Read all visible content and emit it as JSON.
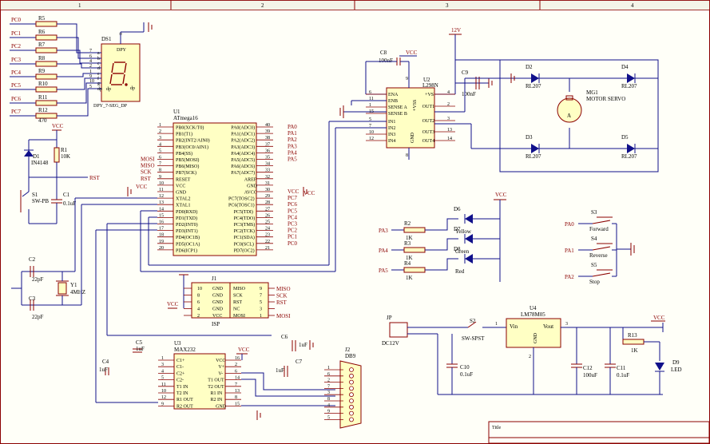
{
  "border": {
    "columns": [
      "1",
      "2",
      "3",
      "4"
    ]
  },
  "power_labels": {
    "vcc": "VCC",
    "v12": "12V"
  },
  "ds1": {
    "ref": "DS1",
    "name": "DPY_7-SEG_DP",
    "top": "DPY",
    "nets": [
      "PC0",
      "PC1",
      "PC2",
      "PC3",
      "PC4",
      "PC5",
      "PC6",
      "PC7"
    ],
    "resistors": [
      "R5",
      "R6",
      "R7",
      "R8",
      "R9",
      "R10",
      "R11",
      "R12"
    ],
    "value": "470",
    "seg_letters": [
      "a",
      "b",
      "c",
      "d",
      "e",
      "f",
      "g",
      "dp"
    ],
    "seg_pins": [
      "7",
      "6",
      "4",
      "2",
      "1",
      "9",
      "10",
      "5"
    ],
    "pin_left_numbers": [
      "7",
      "6",
      "4",
      "2",
      "1",
      "9",
      "10",
      "5"
    ],
    "right_labels": [
      "f",
      "g",
      "e",
      "d",
      "dp",
      "a",
      "b",
      "c"
    ]
  },
  "u1": {
    "ref": "U1",
    "part": "ATmega16",
    "left": [
      {
        "n": "1",
        "name": "PB0(XCK/T0)",
        "net": ""
      },
      {
        "n": "2",
        "name": "PB1(T1)",
        "net": ""
      },
      {
        "n": "3",
        "name": "PB2(INT2/AIN0)",
        "net": ""
      },
      {
        "n": "4",
        "name": "PB3(OC0/AIN1)",
        "net": ""
      },
      {
        "n": "5",
        "name": "PB4(SS)",
        "net": ""
      },
      {
        "n": "6",
        "name": "PB5(MOSI)",
        "net": "MOSI"
      },
      {
        "n": "7",
        "name": "PB6(MISO)",
        "net": "MISO"
      },
      {
        "n": "8",
        "name": "PB7(SCK)",
        "net": "SCK"
      },
      {
        "n": "9",
        "name": "RESET",
        "net": "RST"
      },
      {
        "n": "10",
        "name": "VCC",
        "net": ""
      },
      {
        "n": "11",
        "name": "GND",
        "net": ""
      },
      {
        "n": "12",
        "name": "XTAL2",
        "net": ""
      },
      {
        "n": "13",
        "name": "XTAL1",
        "net": ""
      },
      {
        "n": "14",
        "name": "PD0(RXD)",
        "net": ""
      },
      {
        "n": "15",
        "name": "PD1(TXD)",
        "net": ""
      },
      {
        "n": "16",
        "name": "PD2(INT0)",
        "net": ""
      },
      {
        "n": "17",
        "name": "PD3(INT1)",
        "net": ""
      },
      {
        "n": "18",
        "name": "PD4(OC1B)",
        "net": ""
      },
      {
        "n": "19",
        "name": "PD5(OC1A)",
        "net": ""
      },
      {
        "n": "20",
        "name": "PD6(ICP1)",
        "net": ""
      }
    ],
    "right": [
      {
        "n": "40",
        "name": "PA0(ADC0)",
        "net": "PA0"
      },
      {
        "n": "39",
        "name": "PA1(ADC1)",
        "net": "PA1"
      },
      {
        "n": "38",
        "name": "PA2(ADC2)",
        "net": "PA2"
      },
      {
        "n": "37",
        "name": "PA3(ADC3)",
        "net": "PA3"
      },
      {
        "n": "36",
        "name": "PA4(ADC4)",
        "net": "PA4"
      },
      {
        "n": "35",
        "name": "PA5(ADC5)",
        "net": "PA5"
      },
      {
        "n": "34",
        "name": "PA6(ADC6)",
        "net": ""
      },
      {
        "n": "33",
        "name": "PA7(ADC7)",
        "net": ""
      },
      {
        "n": "32",
        "name": "AREF",
        "net": ""
      },
      {
        "n": "31",
        "name": "GND",
        "net": ""
      },
      {
        "n": "30",
        "name": "AVCC",
        "net": "VCC"
      },
      {
        "n": "29",
        "name": "PC7(TOSC2)",
        "net": "PC7"
      },
      {
        "n": "28",
        "name": "PC6(TOSC1)",
        "net": "PC6"
      },
      {
        "n": "27",
        "name": "PC5(TDI)",
        "net": "PC5"
      },
      {
        "n": "26",
        "name": "PC4(TDO)",
        "net": "PC4"
      },
      {
        "n": "25",
        "name": "PC3(TMS)",
        "net": "PC3"
      },
      {
        "n": "24",
        "name": "PC2(TCK)",
        "net": "PC2"
      },
      {
        "n": "23",
        "name": "PC1(SDA)",
        "net": "PC1"
      },
      {
        "n": "22",
        "name": "PC0(SCL)",
        "net": "PC0"
      },
      {
        "n": "21",
        "name": "PD7(OC2)",
        "net": ""
      }
    ]
  },
  "reset": {
    "d1": "D1",
    "d1v": "IN4148",
    "r1": "R1",
    "r1v": "10K",
    "s1": "S1",
    "s1v": "SW-PB",
    "c1": "C1",
    "c1v": "0.1uF",
    "rst": "RST"
  },
  "crystal": {
    "c2": "C2",
    "c2v": "22pF",
    "c3": "C3",
    "c3v": "22pF",
    "y1": "Y1",
    "y1v": "4MHZ"
  },
  "u2": {
    "ref": "U2",
    "part": "L298N",
    "left": [
      {
        "n": "6",
        "name": "ENA"
      },
      {
        "n": "11",
        "name": "ENB"
      },
      {
        "n": "1",
        "name": "SENSE A"
      },
      {
        "n": "15",
        "name": "SENSE B"
      },
      {
        "n": "5",
        "name": "IN1"
      },
      {
        "n": "7",
        "name": "IN2"
      },
      {
        "n": "10",
        "name": "IN3"
      },
      {
        "n": "12",
        "name": "IN4"
      }
    ],
    "right": [
      {
        "n": "4",
        "name": "+VS"
      },
      {
        "n": "2",
        "name": "OUT1"
      },
      {
        "n": "3",
        "name": "OUT2"
      },
      {
        "n": "13",
        "name": "OUT3"
      },
      {
        "n": "14",
        "name": "OUT4"
      }
    ],
    "vss": "+VSS",
    "vss_n": "9",
    "gnd": "GND",
    "gnd_n": "8",
    "c8": "C8",
    "c8v": "100nF",
    "c9": "C9",
    "c9v": "100nF"
  },
  "motor": {
    "mg": "MG1",
    "mgv": "MOTOR SERVO",
    "a": "A",
    "diodes": [
      {
        "ref": "D2",
        "val": "RL207"
      },
      {
        "ref": "D4",
        "val": "RL207"
      },
      {
        "ref": "D3",
        "val": "RL207"
      },
      {
        "ref": "D5",
        "val": "RL207"
      }
    ]
  },
  "leds": [
    {
      "net": "PA3",
      "r": "R2",
      "rv": "1K",
      "d": "D6",
      "color": "Yellow"
    },
    {
      "net": "PA4",
      "r": "R3",
      "rv": "1K",
      "d": "D7",
      "color": "Green"
    },
    {
      "net": "PA5",
      "r": "R4",
      "rv": "1K",
      "d": "D8",
      "color": "Red"
    }
  ],
  "switches": [
    {
      "net": "PA0",
      "ref": "S3",
      "label": "Forward"
    },
    {
      "net": "PA1",
      "ref": "S4",
      "label": "Reverse"
    },
    {
      "net": "PA2",
      "ref": "S5",
      "label": "Stop"
    }
  ],
  "isp": {
    "ref": "J1",
    "name": "ISP",
    "rows": [
      {
        "l": "10",
        "ln": "GND",
        "rn": "MISO",
        "r": "9",
        "net": "MISO"
      },
      {
        "l": "8",
        "ln": "GND",
        "rn": "SCK",
        "r": "7",
        "net": "SCK"
      },
      {
        "l": "6",
        "ln": "GND",
        "rn": "RST",
        "r": "5",
        "net": "RST"
      },
      {
        "l": "4",
        "ln": "GND",
        "rn": "NC",
        "r": "3",
        "net": ""
      },
      {
        "l": "2",
        "ln": "VCC",
        "rn": "MOSI",
        "r": "1",
        "net": "MOSI"
      }
    ]
  },
  "u3": {
    "ref": "U3",
    "part": "MAX232",
    "left": [
      {
        "n": "1",
        "name": "C1+"
      },
      {
        "n": "3",
        "name": "C1-"
      },
      {
        "n": "4",
        "name": "C2+"
      },
      {
        "n": "5",
        "name": "C2-"
      },
      {
        "n": "11",
        "name": "T1 IN"
      },
      {
        "n": "10",
        "name": "T2 IN"
      },
      {
        "n": "12",
        "name": "R1 OUT"
      },
      {
        "n": "9",
        "name": "R2 OUT"
      }
    ],
    "right": [
      {
        "n": "16",
        "name": "VCC"
      },
      {
        "n": "2",
        "name": "V+"
      },
      {
        "n": "6",
        "name": "V-"
      },
      {
        "n": "14",
        "name": "T1 OUT"
      },
      {
        "n": "7",
        "name": "T2 OUT"
      },
      {
        "n": "13",
        "name": "R1 IN"
      },
      {
        "n": "8",
        "name": "R2 IN"
      },
      {
        "n": "15",
        "name": "GND"
      }
    ],
    "caps": [
      {
        "ref": "C5",
        "val": "1uF"
      },
      {
        "ref": "C4",
        "val": "1uF"
      },
      {
        "ref": "C6",
        "val": "1uF"
      },
      {
        "ref": "C7",
        "val": "1uF"
      }
    ]
  },
  "db9": {
    "ref": "J2",
    "name": "DB9",
    "pins": [
      "1",
      "6",
      "2",
      "7",
      "3",
      "8",
      "4",
      "9",
      "5"
    ]
  },
  "power": {
    "jp": "JP",
    "jpv": "DC12V",
    "s2": "S2",
    "s2v": "SW-SPST",
    "u4": "U4",
    "u4v": "LM78M05",
    "vin": "Vin",
    "vout": "Vout",
    "gnd": "GND",
    "pin1": "1",
    "pin2": "2",
    "pin3": "3",
    "c10": "C10",
    "c10v": "0.1uF",
    "c12": "C12",
    "c12v": "100uF",
    "c11": "C11",
    "c11v": "0.1uF",
    "r13": "R13",
    "r13v": "1K",
    "d9": "D9",
    "d9v": "LED"
  },
  "title_block": {
    "label": "Title"
  }
}
